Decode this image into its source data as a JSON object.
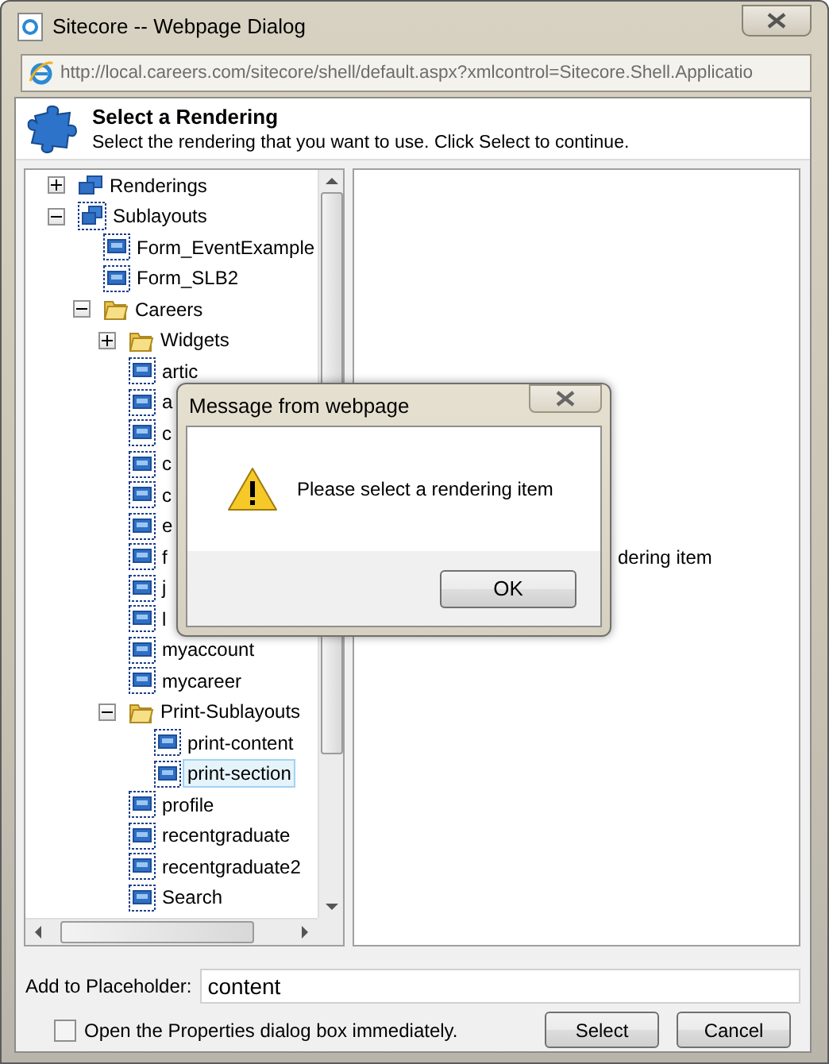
{
  "window": {
    "title": "Sitecore -- Webpage Dialog",
    "address": "http://local.careers.com/sitecore/shell/default.aspx?xmlcontrol=Sitecore.Shell.Applicatio"
  },
  "header": {
    "title": "Select a Rendering",
    "subtitle": "Select the rendering that you want to use. Click Select to continue."
  },
  "tree": [
    {
      "label": "Renderings",
      "kind": "stack",
      "expanded": false,
      "selected": false
    },
    {
      "label": "Sublayouts",
      "kind": "stack-dotted",
      "expanded": true,
      "selected": false,
      "children": [
        {
          "label": "Form_EventExample",
          "kind": "sublayout",
          "selected": false
        },
        {
          "label": "Form_SLB2",
          "kind": "sublayout",
          "selected": false
        },
        {
          "label": "Careers",
          "kind": "folder",
          "expanded": true,
          "selected": false,
          "children": [
            {
              "label": "Widgets",
              "kind": "folder",
              "expanded": false,
              "selected": false
            },
            {
              "label": "artic",
              "kind": "sublayout",
              "selected": false
            },
            {
              "label": "a",
              "kind": "sublayout",
              "selected": false
            },
            {
              "label": "c",
              "kind": "sublayout",
              "selected": false
            },
            {
              "label": "c",
              "kind": "sublayout",
              "selected": false
            },
            {
              "label": "c",
              "kind": "sublayout",
              "selected": false
            },
            {
              "label": "e",
              "kind": "sublayout",
              "selected": false
            },
            {
              "label": "f",
              "kind": "sublayout",
              "selected": false
            },
            {
              "label": "j",
              "kind": "sublayout",
              "selected": false
            },
            {
              "label": "l",
              "kind": "sublayout",
              "selected": false
            },
            {
              "label": "myaccount",
              "kind": "sublayout",
              "selected": false
            },
            {
              "label": "mycareer",
              "kind": "sublayout",
              "selected": false
            },
            {
              "label": "Print-Sublayouts",
              "kind": "folder",
              "expanded": true,
              "selected": false,
              "children": [
                {
                  "label": "print-content",
                  "kind": "sublayout",
                  "selected": false
                },
                {
                  "label": "print-section",
                  "kind": "sublayout",
                  "selected": true
                }
              ]
            },
            {
              "label": "profile",
              "kind": "sublayout",
              "selected": false
            },
            {
              "label": "recentgraduate",
              "kind": "sublayout",
              "selected": false
            },
            {
              "label": "recentgraduate2",
              "kind": "sublayout",
              "selected": false
            },
            {
              "label": "Search",
              "kind": "sublayout",
              "selected": false
            }
          ]
        }
      ]
    }
  ],
  "preview": {
    "message": "dering item"
  },
  "placeholder": {
    "label": "Add to Placeholder:",
    "value": "content"
  },
  "open_properties": {
    "label": "Open the Properties dialog box immediately.",
    "checked": false
  },
  "buttons": [
    "Select",
    "Cancel"
  ],
  "message_box": {
    "title": "Message from webpage",
    "text": "Please select a rendering item",
    "button": "OK"
  }
}
